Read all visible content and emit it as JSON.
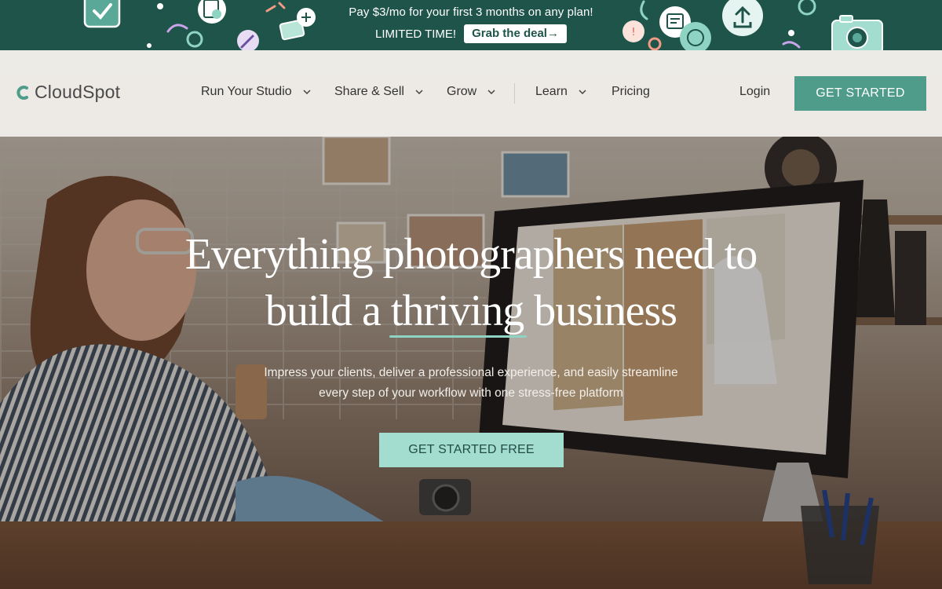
{
  "promo": {
    "line1": "Pay $3/mo for your first 3 months on any plan!",
    "limited": "LIMITED TIME!",
    "grab": "Grab the deal→"
  },
  "brand": {
    "name": "CloudSpot",
    "accent": "#4f9c8b",
    "banner_bg": "#1e5449",
    "highlight": "#8fd3c2"
  },
  "nav": {
    "items": [
      {
        "label": "Run Your Studio",
        "icon": "chevron-down-icon"
      },
      {
        "label": "Share & Sell",
        "icon": "chevron-down-icon"
      },
      {
        "label": "Grow",
        "icon": "chevron-down-icon"
      },
      {
        "label": "Learn",
        "icon": "chevron-down-icon"
      },
      {
        "label": "Pricing"
      }
    ],
    "login": "Login",
    "get_started": "GET STARTED"
  },
  "hero": {
    "headline_1": "Everything photographers need to",
    "headline_2a": "build a ",
    "headline_2b": "thriving",
    "headline_2c": " business",
    "sub_1": "Impress your clients, deliver a professional experience, and easily streamline",
    "sub_2": "every step of your workflow with one stress-free platform",
    "cta": "GET STARTED FREE"
  }
}
